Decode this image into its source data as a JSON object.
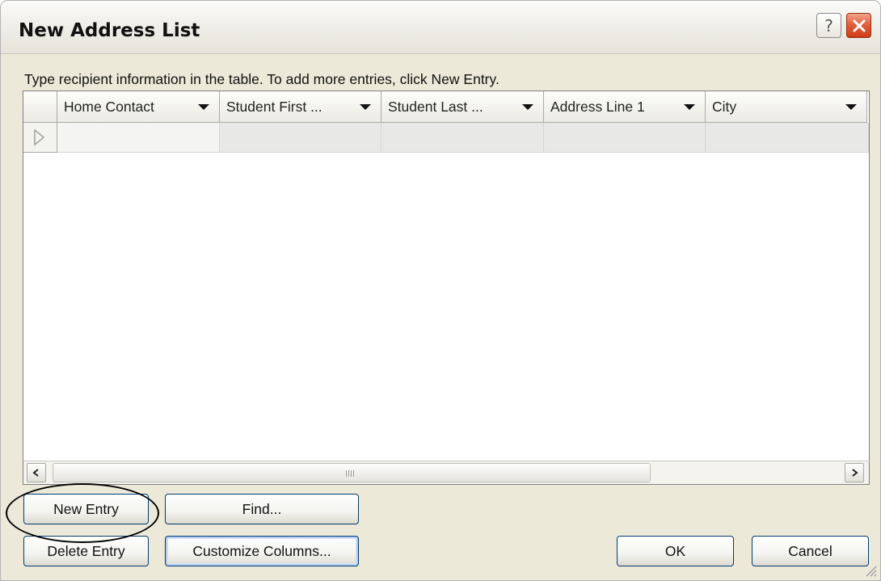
{
  "window": {
    "title": "New Address List",
    "help_glyph": "?",
    "close_icon": "close-x-icon"
  },
  "instruction": "Type recipient information in the table.  To add more entries, click New Entry.",
  "table": {
    "columns": [
      "Home Contact",
      "Student First ...",
      "Student Last ...",
      "Address Line 1",
      "City"
    ],
    "rows": [
      [
        "",
        "",
        "",
        "",
        ""
      ]
    ],
    "row_marker_icon": "row-pointer-icon"
  },
  "scrollbar": {
    "left_icon": "scroll-left-icon",
    "right_icon": "scroll-right-icon"
  },
  "buttons": {
    "new_entry": "New Entry",
    "find": "Find...",
    "delete_entry": "Delete Entry",
    "customize_columns": "Customize Columns...",
    "ok": "OK",
    "cancel": "Cancel"
  },
  "colors": {
    "dialog_bg": "#ece9d8",
    "close_button": "#e2603c",
    "button_border": "#003c74"
  }
}
